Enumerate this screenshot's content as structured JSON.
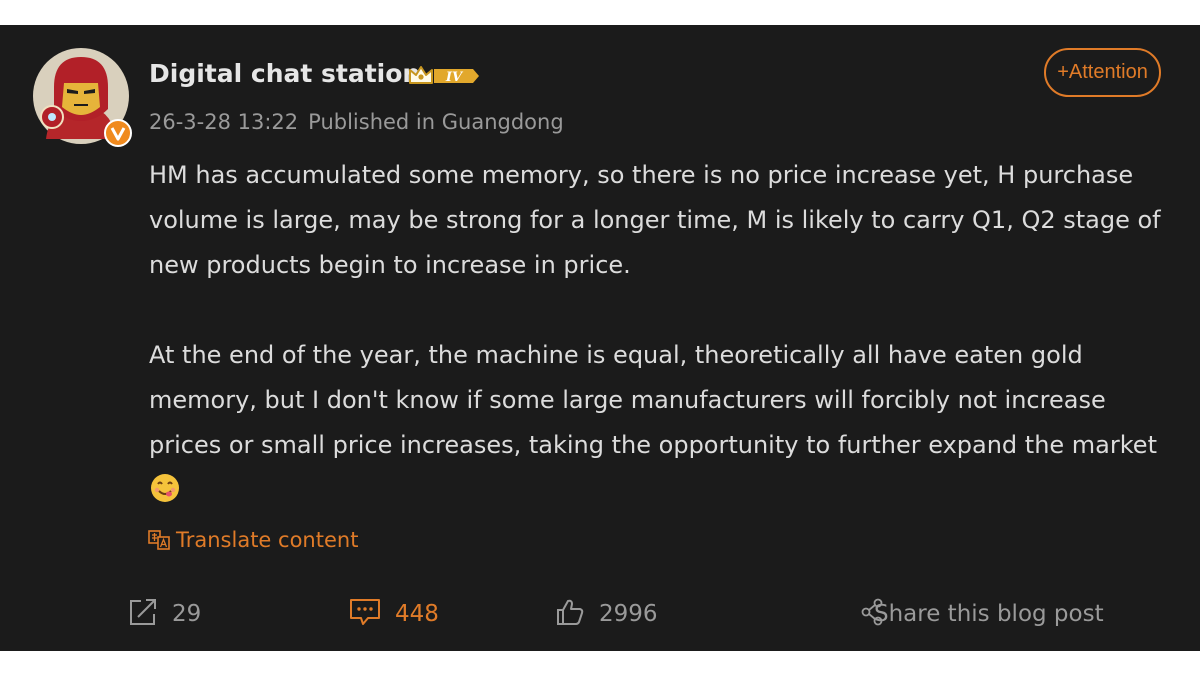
{
  "post": {
    "author": {
      "name": "Digital chat station",
      "level_badge": "IV",
      "verified_badge": "V"
    },
    "timestamp": "26-3-28 13:22",
    "location": "Published in Guangdong",
    "follow_label": "+Attention",
    "paragraphs": [
      "HM has accumulated some memory, so there is no price increase yet, H purchase volume is large, may be strong for a longer time, M is likely to carry Q1, Q2 stage of new products begin to increase in price.",
      "At the end of the year, the machine is equal, theoretically all have eaten gold memory, but I don't know if some large manufacturers will forcibly not increase prices or small price increases, taking the opportunity to further expand the market"
    ],
    "translate_label": "Translate content",
    "actions": {
      "reposts": "29",
      "comments": "448",
      "likes": "2996",
      "share_label": "Share this blog post"
    }
  },
  "colors": {
    "background": "#1b1b1b",
    "accent": "#e07b28",
    "text": "#dcdcdc",
    "muted": "#9a9a9a"
  },
  "icons": [
    "avatar-ironman-cartoon",
    "verified-v-icon",
    "crown-rank-icon",
    "translate-icon",
    "repost-icon",
    "comment-icon",
    "like-icon",
    "share-icon",
    "yummy-face-emoji"
  ]
}
